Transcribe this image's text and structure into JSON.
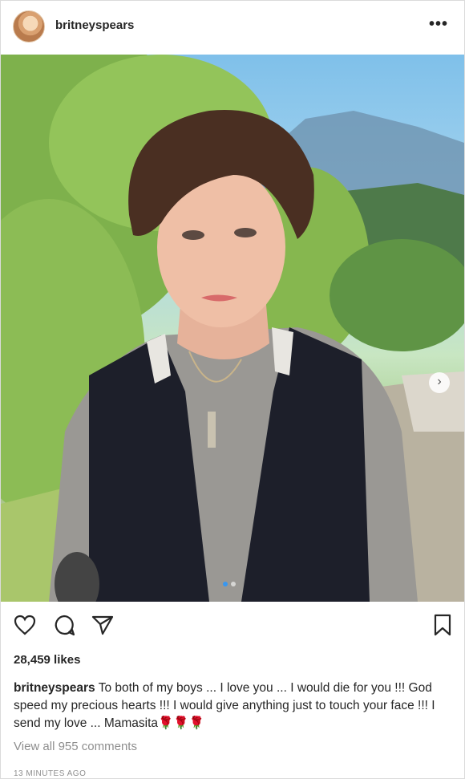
{
  "post": {
    "username": "britneyspears",
    "more_label": "•••",
    "next_arrow": "›",
    "likes": "28,459 likes",
    "caption_user": "britneyspears",
    "caption_text": "To both of my boys ... I love you ... I would die for you !!! God speed my precious hearts !!! I would give anything just to touch your face !!! I send my love ... Mamasita🌹🌹🌹",
    "view_comments": "View all 955 comments",
    "timestamp": "13 MINUTES AGO"
  },
  "carousel": {
    "count": 2,
    "current": 1
  },
  "icons": {
    "more": "more-options-icon",
    "like": "heart-icon",
    "comment": "comment-icon",
    "share": "paper-plane-icon",
    "save": "bookmark-icon",
    "next": "chevron-right-icon"
  },
  "colors": {
    "text": "#262626",
    "secondary": "#8e8e8e",
    "active_dot": "#3897f0"
  }
}
